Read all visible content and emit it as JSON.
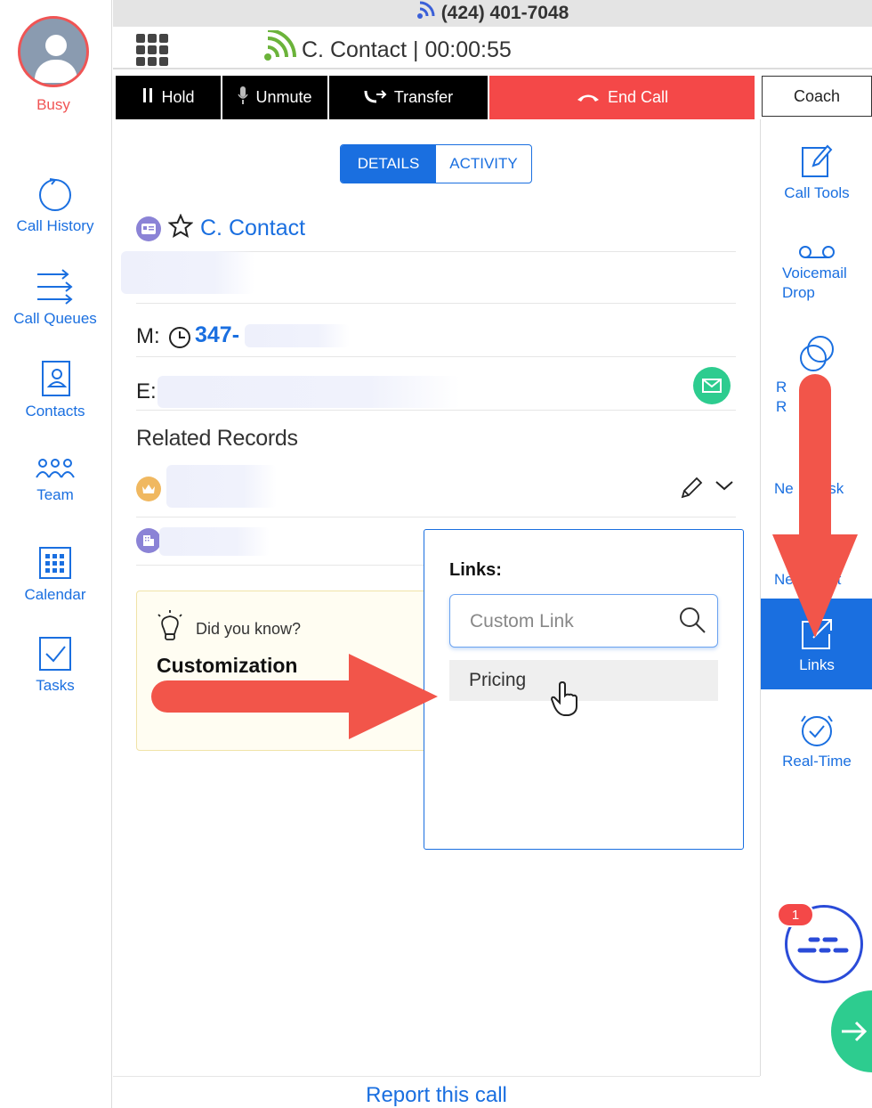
{
  "header": {
    "phone_number": "(424) 401-7048",
    "call_title": "C. Contact | 00:00:55"
  },
  "user": {
    "status": "Busy"
  },
  "left_nav": {
    "items": [
      {
        "label": "Call History",
        "icon": "history-icon"
      },
      {
        "label": "Call Queues",
        "icon": "queues-icon"
      },
      {
        "label": "Contacts",
        "icon": "contacts-icon"
      },
      {
        "label": "Team",
        "icon": "team-icon"
      },
      {
        "label": "Calendar",
        "icon": "calendar-icon"
      },
      {
        "label": "Tasks",
        "icon": "tasks-icon"
      }
    ]
  },
  "controls": {
    "hold": "Hold",
    "unmute": "Unmute",
    "transfer": "Transfer",
    "end_call": "End Call",
    "coach": "Coach"
  },
  "tabs": {
    "details": "DETAILS",
    "activity": "ACTIVITY",
    "active": "DETAILS"
  },
  "contact": {
    "name": "C. Contact",
    "mobile_label": "M:",
    "mobile_value": "347-",
    "email_label": "E:"
  },
  "related": {
    "title": "Related Records"
  },
  "tip": {
    "question": "Did you know?",
    "title": "Customization"
  },
  "links_popup": {
    "title": "Links:",
    "search_placeholder": "Custom Link",
    "options": [
      "Pricing"
    ]
  },
  "right_nav": {
    "items": [
      {
        "label": "Call Tools",
        "icon": "edit-icon"
      },
      {
        "label": "Voicemail Drop",
        "icon": "voicemail-icon"
      },
      {
        "label": "Related Records",
        "icon": "related-records-icon"
      },
      {
        "label": "New Task",
        "icon": "task-icon"
      },
      {
        "label": "New Event",
        "icon": "event-icon"
      },
      {
        "label": "Links",
        "icon": "external-link-icon",
        "active": true
      },
      {
        "label": "Real-Time",
        "icon": "realtime-icon"
      }
    ],
    "visible_fragments": {
      "related_line1_a": "R",
      "related_line1_b": "ed",
      "related_line2_a": "R",
      "related_line2_b": "ds",
      "task_a": "Ne",
      "task_b": "ask",
      "event_a": "Ne",
      "event_b": "ent"
    }
  },
  "notification": {
    "count": "1"
  },
  "footer": {
    "report": "Report this call"
  },
  "colors": {
    "accent": "#1a6fe0",
    "danger": "#f44848",
    "success": "#2dcc8f",
    "arrow": "#f2554a"
  }
}
